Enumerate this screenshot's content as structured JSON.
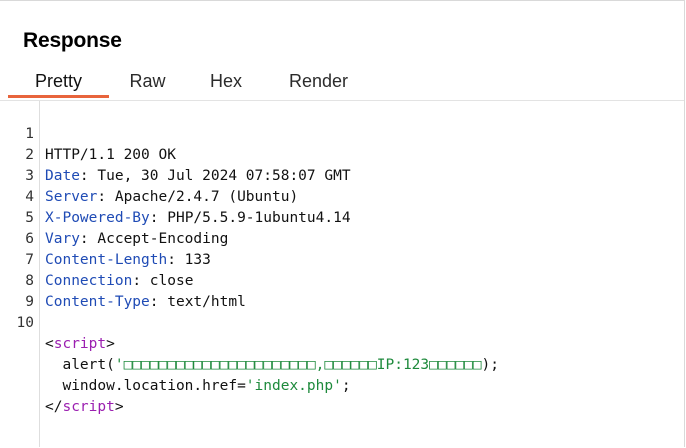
{
  "panel": {
    "title": "Response"
  },
  "tabs": [
    {
      "label": "Pretty",
      "active": true
    },
    {
      "label": "Raw",
      "active": false
    },
    {
      "label": "Hex",
      "active": false
    },
    {
      "label": "Render",
      "active": false
    }
  ],
  "colors": {
    "active_tab_underline": "#e8643c",
    "header_key": "#1f4bb5",
    "tag_name": "#9b1fb0",
    "string": "#1e8a3c"
  },
  "lines": [
    {
      "num": "1",
      "status": "HTTP/1.1 200 OK"
    },
    {
      "num": "2",
      "key": "Date",
      "value": " Tue, 30 Jul 2024 07:58:07 GMT"
    },
    {
      "num": "3",
      "key": "Server",
      "value": " Apache/2.4.7 (Ubuntu)"
    },
    {
      "num": "4",
      "key": "X-Powered-By",
      "value": " PHP/5.5.9-1ubuntu4.14"
    },
    {
      "num": "5",
      "key": "Vary",
      "value": " Accept-Encoding"
    },
    {
      "num": "6",
      "key": "Content-Length",
      "value": " 133"
    },
    {
      "num": "7",
      "key": "Connection",
      "value": " close"
    },
    {
      "num": "8",
      "key": "Content-Type",
      "value": " text/html"
    },
    {
      "num": "9"
    },
    {
      "num": "10",
      "open_bracket": "<",
      "tag": "script",
      "close_bracket": ">"
    },
    {
      "indent": "  ",
      "fn": "alert(",
      "str": "'□□□□□□□□□□□□□□□□□□□□□□,□□□□□□IP:123□□□□□□",
      "end": ");"
    },
    {
      "indent": "  ",
      "fn": "window.location.href=",
      "str": "'index.php'",
      "end": ";"
    },
    {
      "open_bracket": "</",
      "tag": "script",
      "close_bracket": ">"
    }
  ]
}
